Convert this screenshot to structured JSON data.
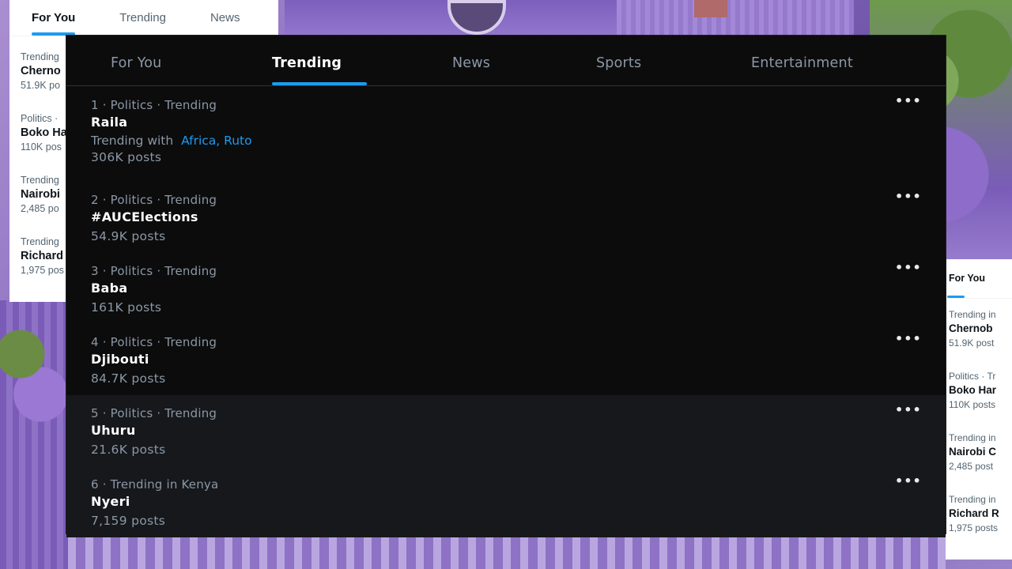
{
  "left_panel": {
    "tabs": [
      {
        "label": "For You",
        "active": true
      },
      {
        "label": "Trending",
        "active": false
      },
      {
        "label": "News",
        "active": false
      }
    ],
    "items": [
      {
        "meta": "Trending",
        "title": "Cherno",
        "posts": "51.9K po"
      },
      {
        "meta": "Politics ·",
        "title": "Boko Ha",
        "posts": "110K pos"
      },
      {
        "meta": "Trending",
        "title": "Nairobi",
        "posts": "2,485 po"
      },
      {
        "meta": "Trending",
        "title": "Richard",
        "posts": "1,975 pos"
      }
    ]
  },
  "right_panel": {
    "tabs": [
      {
        "label": "For You",
        "active": true
      }
    ],
    "items": [
      {
        "meta": "Trending in",
        "title": "Chernob",
        "posts": "51.9K post"
      },
      {
        "meta": "Politics · Tr",
        "title": "Boko Har",
        "posts": "110K posts"
      },
      {
        "meta": "Trending in",
        "title": "Nairobi C",
        "posts": "2,485 post"
      },
      {
        "meta": "Trending in",
        "title": "Richard R",
        "posts": "1,975 posts"
      }
    ]
  },
  "main": {
    "tabs": [
      {
        "label": "For You",
        "active": false
      },
      {
        "label": "Trending",
        "active": true
      },
      {
        "label": "News",
        "active": false
      },
      {
        "label": "Sports",
        "active": false
      },
      {
        "label": "Entertainment",
        "active": false
      }
    ],
    "more_icon": "more-horizontal-icon",
    "trends": [
      {
        "meta": "1 · Politics · Trending",
        "title": "Raila",
        "with_label": "Trending with",
        "with_links": [
          "Africa",
          "Ruto"
        ],
        "posts": "306K posts"
      },
      {
        "meta": "2 · Politics · Trending",
        "title": "#AUCElections",
        "posts": "54.9K posts"
      },
      {
        "meta": "3 · Politics · Trending",
        "title": "Baba",
        "posts": "161K posts"
      },
      {
        "meta": "4 · Politics · Trending",
        "title": "Djibouti",
        "posts": "84.7K posts"
      },
      {
        "meta": "5 · Politics · Trending",
        "title": "Uhuru",
        "posts": "21.6K posts"
      },
      {
        "meta": "6 · Trending in Kenya",
        "title": "Nyeri",
        "posts": "7,159 posts"
      }
    ]
  },
  "colors": {
    "accent": "#1d9bf0",
    "dark_bg": "#0c0c0d",
    "muted_text": "#8b98a5"
  }
}
